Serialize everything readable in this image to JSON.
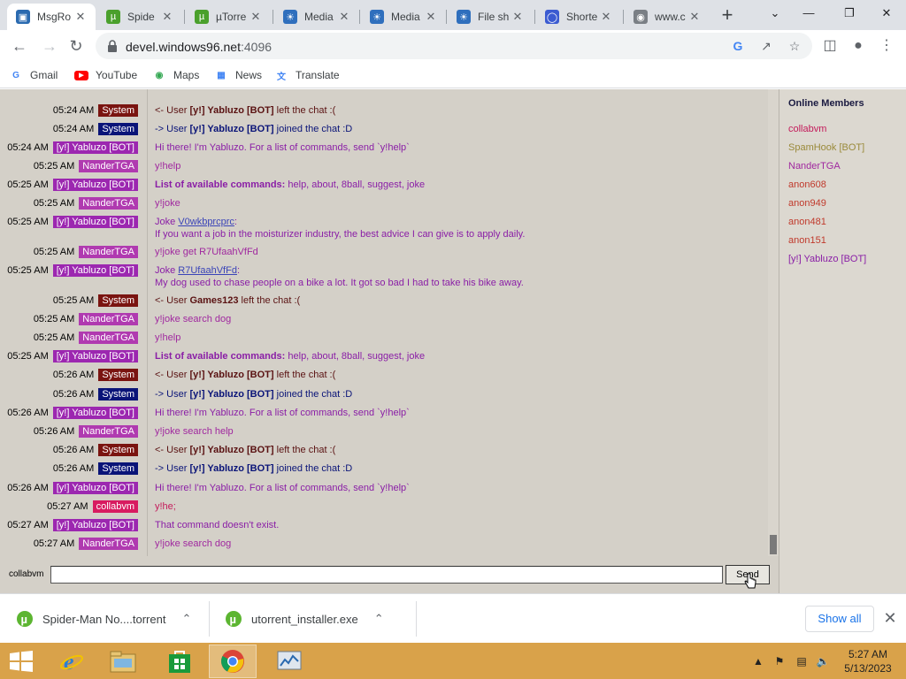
{
  "browser": {
    "tabs": [
      {
        "title": "MsgRo",
        "icon": "msgroom-icon",
        "active": true
      },
      {
        "title": "Spide",
        "icon": "utorrent-icon"
      },
      {
        "title": "µTorre",
        "icon": "utorrent-icon"
      },
      {
        "title": "Media",
        "icon": "edge-icon"
      },
      {
        "title": "Media",
        "icon": "edge-icon"
      },
      {
        "title": "File sh",
        "icon": "edge-icon"
      },
      {
        "title": "Shorte",
        "icon": "shortener-icon"
      },
      {
        "title": "www.c",
        "icon": "globe-icon"
      }
    ],
    "url_host": "devel.windows96.net",
    "url_port": ":4096",
    "bookmarks": [
      {
        "label": "Gmail",
        "icon": "google-icon"
      },
      {
        "label": "YouTube",
        "icon": "youtube-icon"
      },
      {
        "label": "Maps",
        "icon": "maps-icon"
      },
      {
        "label": "News",
        "icon": "news-icon"
      },
      {
        "label": "Translate",
        "icon": "translate-icon"
      }
    ]
  },
  "chat": {
    "messages": [
      {
        "time": "05:24 AM",
        "user": "System",
        "kind": "system",
        "html": "&lt;- User <b>[y!] Yabluzo [BOT]</b> left the chat :("
      },
      {
        "time": "05:24 AM",
        "user": "System",
        "kind": "system2",
        "html": "-&gt; User <b>[y!] Yabluzo [BOT]</b> joined the chat :D"
      },
      {
        "time": "05:24 AM",
        "user": "[y!] Yabluzo [BOT]",
        "kind": "bot",
        "html": "Hi there! I'm Yabluzo. For a list of commands, send `y!help`"
      },
      {
        "time": "05:25 AM",
        "user": "NanderTGA",
        "kind": "nander",
        "html": "y!help"
      },
      {
        "time": "05:25 AM",
        "user": "[y!] Yabluzo [BOT]",
        "kind": "bot",
        "html": "<b>List of available commands:</b> help, about, 8ball, suggest, joke"
      },
      {
        "time": "05:25 AM",
        "user": "NanderTGA",
        "kind": "nander",
        "html": "y!joke"
      },
      {
        "time": "05:25 AM",
        "user": "[y!] Yabluzo [BOT]",
        "kind": "bot",
        "html": "Joke <a>V0wkbprcprc</a>:<br>If you want a job in the moisturizer industry, the best advice I can give is to apply daily."
      },
      {
        "time": "05:25 AM",
        "user": "NanderTGA",
        "kind": "nander",
        "html": "y!joke get R7UfaahVfFd"
      },
      {
        "time": "05:25 AM",
        "user": "[y!] Yabluzo [BOT]",
        "kind": "bot",
        "html": "Joke <a>R7UfaahVfFd</a>:<br>My dog used to chase people on a bike a lot. It got so bad I had to take his bike away."
      },
      {
        "time": "05:25 AM",
        "user": "System",
        "kind": "system",
        "html": "&lt;- User <b>Games123</b> left the chat :("
      },
      {
        "time": "05:25 AM",
        "user": "NanderTGA",
        "kind": "nander",
        "html": "y!joke search dog"
      },
      {
        "time": "05:25 AM",
        "user": "NanderTGA",
        "kind": "nander",
        "html": "y!help"
      },
      {
        "time": "05:25 AM",
        "user": "[y!] Yabluzo [BOT]",
        "kind": "bot",
        "html": "<b>List of available commands:</b> help, about, 8ball, suggest, joke"
      },
      {
        "time": "05:26 AM",
        "user": "System",
        "kind": "system",
        "html": "&lt;- User <b>[y!] Yabluzo [BOT]</b> left the chat :("
      },
      {
        "time": "05:26 AM",
        "user": "System",
        "kind": "system2",
        "html": "-&gt; User <b>[y!] Yabluzo [BOT]</b> joined the chat :D"
      },
      {
        "time": "05:26 AM",
        "user": "[y!] Yabluzo [BOT]",
        "kind": "bot",
        "html": "Hi there! I'm Yabluzo. For a list of commands, send `y!help`"
      },
      {
        "time": "05:26 AM",
        "user": "NanderTGA",
        "kind": "nander",
        "html": "y!joke search help"
      },
      {
        "time": "05:26 AM",
        "user": "System",
        "kind": "system",
        "html": "&lt;- User <b>[y!] Yabluzo [BOT]</b> left the chat :("
      },
      {
        "time": "05:26 AM",
        "user": "System",
        "kind": "system2",
        "html": "-&gt; User <b>[y!] Yabluzo [BOT]</b> joined the chat :D"
      },
      {
        "time": "05:26 AM",
        "user": "[y!] Yabluzo [BOT]",
        "kind": "bot",
        "html": "Hi there! I'm Yabluzo. For a list of commands, send `y!help`"
      },
      {
        "time": "05:27 AM",
        "user": "collabvm",
        "kind": "collab",
        "html": "y!he;"
      },
      {
        "time": "05:27 AM",
        "user": "[y!] Yabluzo [BOT]",
        "kind": "bot",
        "html": "That command doesn't exist."
      },
      {
        "time": "05:27 AM",
        "user": "NanderTGA",
        "kind": "nander",
        "html": "y!joke search dog"
      }
    ],
    "members_title": "Online Members",
    "members": [
      {
        "name": "collabvm",
        "color": "#c41a5a"
      },
      {
        "name": "SpamHook [BOT]",
        "color": "#9a8a3a"
      },
      {
        "name": "NanderTGA",
        "color": "#a0289f"
      },
      {
        "name": "anon608",
        "color": "#c0392b"
      },
      {
        "name": "anon949",
        "color": "#c0392b"
      },
      {
        "name": "anon481",
        "color": "#c0392b"
      },
      {
        "name": "anon151",
        "color": "#c0392b"
      },
      {
        "name": "[y!] Yabluzo [BOT]",
        "color": "#8a1ea6"
      }
    ],
    "input_username": "collabvm",
    "input_value": "",
    "send_label": "Send"
  },
  "downloads": {
    "items": [
      {
        "name": "Spider-Man No....torrent"
      },
      {
        "name": "utorrent_installer.exe"
      }
    ],
    "show_all_label": "Show all"
  },
  "taskbar": {
    "time": "5:27 AM",
    "date": "5/13/2023"
  }
}
